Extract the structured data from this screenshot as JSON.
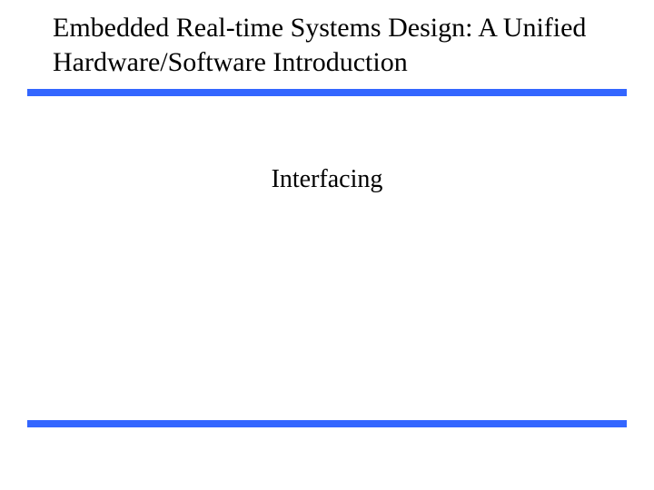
{
  "slide": {
    "title": "Embedded Real-time Systems Design: A Unified Hardware/Software Introduction",
    "subtitle": "Interfacing"
  }
}
